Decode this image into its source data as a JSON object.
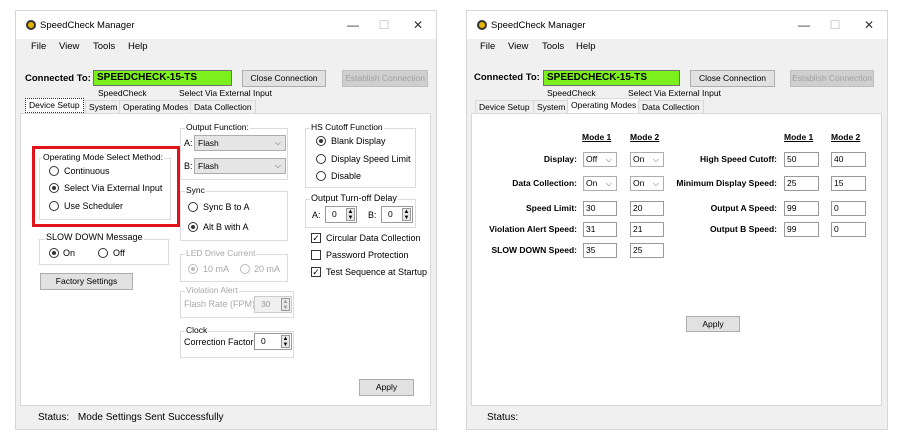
{
  "app": {
    "title": "SpeedCheck Manager",
    "menu": [
      "File",
      "View",
      "Tools",
      "Help"
    ],
    "window_controls": [
      "minimize",
      "maximize",
      "close"
    ],
    "highlight_color": "#e0131a"
  },
  "connection": {
    "label": "Connected To:",
    "device": "SPEEDCHECK-15-TS",
    "close_button": "Close Connection",
    "establish_button": "Establish Connection",
    "sub_device": "SpeedCheck",
    "sub_mode": "Select Via External Input",
    "device_color": "#7cf01c"
  },
  "tabs": [
    "Device Setup",
    "System",
    "Operating Modes",
    "Data Collection"
  ],
  "left": {
    "active_tab": "Device Setup",
    "mode_select": {
      "title": "Operating Mode Select Method:",
      "options": [
        "Continuous",
        "Select Via External Input",
        "Use Scheduler"
      ],
      "selected": "Select Via External Input"
    },
    "slow_down": {
      "title": "SLOW DOWN Message",
      "options": [
        "On",
        "Off"
      ],
      "selected": "On"
    },
    "factory_button": "Factory Settings",
    "output_function": {
      "title": "Output Function:",
      "a_label": "A:",
      "a_value": "Flash",
      "b_label": "B:",
      "b_value": "Flash"
    },
    "sync": {
      "title": "Sync",
      "options": [
        "Sync B to A",
        "Alt B with A"
      ],
      "selected": "Alt B with A"
    },
    "led": {
      "title": "LED Drive Current",
      "options": [
        "10 mA",
        "20 mA"
      ],
      "selected": "10 mA"
    },
    "violation": {
      "title": "Violation Alert",
      "label": "Flash Rate (FPM)",
      "value": "30"
    },
    "clock": {
      "title": "Clock",
      "label": "Correction Factor:",
      "value": "0"
    },
    "hs_cutoff": {
      "title": "HS Cutoff Function",
      "options": [
        "Blank Display",
        "Display Speed Limit",
        "Disable"
      ],
      "selected": "Blank Display"
    },
    "turnoff": {
      "title": "Output Turn-off Delay",
      "a_label": "A:",
      "a_value": "0",
      "b_label": "B:",
      "b_value": "0"
    },
    "checkboxes": [
      {
        "label": "Circular Data Collection",
        "checked": true
      },
      {
        "label": "Password Protection",
        "checked": false
      },
      {
        "label": "Test Sequence at Startup",
        "checked": true
      }
    ],
    "apply": "Apply",
    "status_label": "Status:",
    "status_text": "Mode Settings Sent Successfully"
  },
  "right": {
    "active_tab": "Operating Modes",
    "mode1": "Mode 1",
    "mode2": "Mode 2",
    "left_rows": [
      {
        "label": "Display:",
        "m1": "Off",
        "m2": "On",
        "type": "select"
      },
      {
        "label": "Data Collection:",
        "m1": "On",
        "m2": "On",
        "type": "select"
      },
      {
        "label": "Speed Limit:",
        "m1": "30",
        "m2": "20",
        "type": "input"
      },
      {
        "label": "Violation Alert Speed:",
        "m1": "31",
        "m2": "21",
        "type": "input"
      },
      {
        "label": "SLOW DOWN Speed:",
        "m1": "35",
        "m2": "25",
        "type": "input"
      }
    ],
    "right_rows": [
      {
        "label": "High Speed Cutoff:",
        "m1": "50",
        "m2": "40"
      },
      {
        "label": "Minimum Display Speed:",
        "m1": "25",
        "m2": "15"
      },
      {
        "label": "Output A Speed:",
        "m1": "99",
        "m2": "0"
      },
      {
        "label": "Output B Speed:",
        "m1": "99",
        "m2": "0"
      }
    ],
    "apply": "Apply",
    "status_label": "Status:"
  }
}
